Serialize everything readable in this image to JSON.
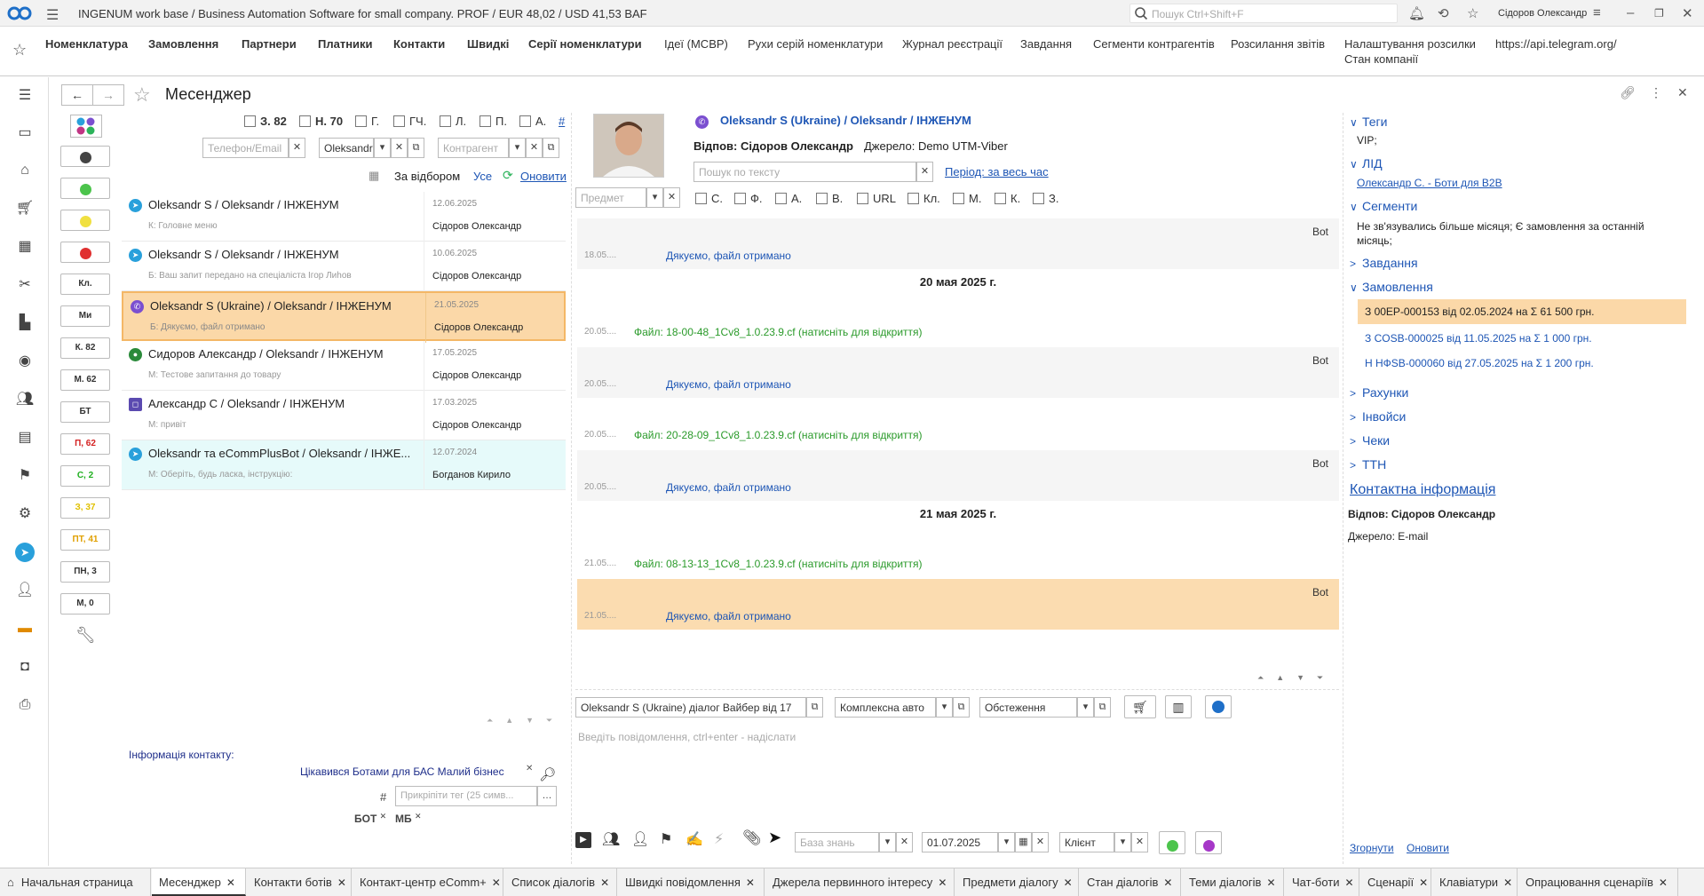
{
  "app": {
    "title": "INGENUM work base / Business Automation Software for small company. PROF / EUR 48,02 / USD 41,53  BAF",
    "search_placeholder": "Пошук Ctrl+Shift+F",
    "user": "Сідоров Олександр"
  },
  "nav": {
    "items": [
      "Номенклатура",
      "Замовлення",
      "Партнери",
      "Платники",
      "Контакти",
      "Швидкі",
      "Серії номенклатури",
      "Ідеї (МСВР)",
      "Рухи серій номенклатури",
      "Журнал реєстрації",
      "Завдання",
      "Сегменти контрагентів",
      "Розсилання звітів",
      "Налаштування розсилки",
      "https://api.telegram.org/"
    ],
    "sub_item": "Стан компанії"
  },
  "page": {
    "title": "Месенджер"
  },
  "filters": {
    "buttons": [
      "Кл.",
      "Ми",
      "К. 82",
      "М. 62",
      "БТ",
      "П, 62",
      "С, 2",
      "З, 37",
      "ПТ, 41",
      "ПН, 3",
      "М, 0"
    ],
    "button_colors": [
      "#333333",
      "#333333",
      "#333333",
      "#333333",
      "#333333",
      "#d42020",
      "#20b020",
      "#e0c000",
      "#e0a000",
      "#333333",
      "#333333"
    ],
    "status_dots": [
      "#444444",
      "#4cc44c",
      "#f0e040",
      "#e03030"
    ],
    "checks": [
      "З. 82",
      "Н. 70",
      "Г.",
      "ГЧ.",
      "Л.",
      "П.",
      "А."
    ],
    "hash": "#",
    "phone_placeholder": "Телефон/Email",
    "manager_value": "Oleksandr",
    "counterparty_placeholder": "Контрагент",
    "by_selection": "За відбором",
    "all": "Усе",
    "refresh": "Оновити"
  },
  "dialogs": [
    {
      "name": "Oleksandr S / Oleksandr / ІНЖЕНУМ",
      "sub": "К: Головне меню",
      "date": "12.06.2025",
      "who": "Сідоров Олександр",
      "icon": "telegram"
    },
    {
      "name": "Oleksandr S / Oleksandr / ІНЖЕНУМ",
      "sub": "Б: Ваш запит передано на спеціаліста Ігор Лиhов",
      "date": "10.06.2025",
      "who": "Сідоров Олександр",
      "icon": "telegram"
    },
    {
      "name": "Oleksandr S (Ukraine) / Oleksandr / ІНЖЕНУМ",
      "sub": "Б: Дякуємо, файл отримано",
      "date": "21.05.2025",
      "who": "Сідоров Олександр",
      "icon": "viber"
    },
    {
      "name": "Сидоров Александр / Oleksandr / ІНЖЕНУМ",
      "sub": "М: Тестове запитання до товару",
      "date": "17.05.2025",
      "who": "Сідоров Олександр",
      "icon": "chat"
    },
    {
      "name": "Александр С / Oleksandr / ІНЖЕНУМ",
      "sub": "М: привіт",
      "date": "17.03.2025",
      "who": "Сідоров Олександр",
      "icon": "instagram"
    },
    {
      "name": "Oleksandr та eCommPlusBot / Oleksandr / ІНЖЕ...",
      "sub": "М: Оберіть, будь ласка, інструкцію:",
      "date": "12.07.2024",
      "who": "Богданов Кирило",
      "icon": "telegram"
    }
  ],
  "contact_info": {
    "label": "Інформація контакту:",
    "interest": "Цікавився Ботами для БАС Малий бізнес",
    "tag_placeholder": "Прикріпіти тег (25 симв...",
    "hash": "#",
    "tags": [
      "БОТ",
      "МБ"
    ]
  },
  "chat": {
    "contact_name": "Oleksandr S (Ukraine) / Oleksandr / ІНЖЕНУМ",
    "responsible": "Відпов: Сідоров Олександр",
    "source": "Джерело: Demo UTM-Viber",
    "search_placeholder": "Пошук по тексту",
    "period": "Період: за весь час",
    "subject_placeholder": "Предмет",
    "checks": [
      "С.",
      "Ф.",
      "А.",
      "В.",
      "URL",
      "Кл.",
      "М.",
      "К.",
      "З."
    ],
    "messages": [
      {
        "kind": "bot",
        "time": "18.05....",
        "text": "Дякуємо, файл отримано",
        "bot": "Bot"
      },
      {
        "kind": "date",
        "text": "20 мая 2025 г."
      },
      {
        "kind": "file",
        "time": "20.05....",
        "text": "Файл: 18-00-48_1Cv8_1.0.23.9.cf (натисніть для відкриття)"
      },
      {
        "kind": "bot",
        "time": "20.05....",
        "text": "Дякуємо, файл отримано",
        "bot": "Bot"
      },
      {
        "kind": "file",
        "time": "20.05....",
        "text": "Файл: 20-28-09_1Cv8_1.0.23.9.cf (натисніть для відкриття)"
      },
      {
        "kind": "bot",
        "time": "20.05....",
        "text": "Дякуємо, файл отримано",
        "bot": "Bot"
      },
      {
        "kind": "date",
        "text": "21 мая 2025 г."
      },
      {
        "kind": "file",
        "time": "21.05....",
        "text": "Файл: 08-13-13_1Cv8_1.0.23.9.cf (натисніть для відкриття)"
      },
      {
        "kind": "bot",
        "time": "21.05....",
        "text": "Дякуємо, файл отримано",
        "bot": "Bot"
      }
    ],
    "dialog_field": "Oleksandr S (Ukraine) діалог Вайбер від 17",
    "automation_field": "Комплексна авто",
    "service_field": "Обстеження",
    "input_placeholder": "Введіть повідомлення, ctrl+enter - надіслати",
    "kb_placeholder": "База знань",
    "date_value": "01.07.2025",
    "role_value": "Клієнт"
  },
  "right": {
    "tags_title": "Теги",
    "tags_value": "VIP;",
    "lead_title": "ЛІД",
    "lead_value": "Олександр С. - Боти для В2В",
    "segments_title": "Сегменти",
    "segments_value": "Не зв'язувались більше місяця; Є замовлення за останній місяць;",
    "tasks_title": "Завдання",
    "orders_title": "Замовлення",
    "orders": [
      "З 00ЕР-000153 від 02.05.2024 на Σ 61 500 грн.",
      "З COSB-000025 від 11.05.2025 на Σ 1 000 грн.",
      "Н НФSB-000060 від 27.05.2025 на Σ 1 200 грн."
    ],
    "invoices_title": "Рахунки",
    "invoices2_title": "Інвойси",
    "checks_title": "Чеки",
    "ttn_title": "ТТН",
    "contact_title": "Контактна інформація",
    "responsible": "Відпов: Сідоров Олександр",
    "source": "Джерело: E-mail",
    "collapse": "Згорнути",
    "refresh": "Оновити"
  },
  "tabs": [
    "Начальная страница",
    "Месенджер",
    "Контакти ботів",
    "Контакт-центр eComm+",
    "Список діалогів",
    "Швидкі повідомлення",
    "Джерела первинного інтересу",
    "Предмети діалогу",
    "Стан діалогів",
    "Теми діалогів",
    "Чат-боти",
    "Сценарії",
    "Клавіатури",
    "Опрацювання сценаріїв"
  ]
}
